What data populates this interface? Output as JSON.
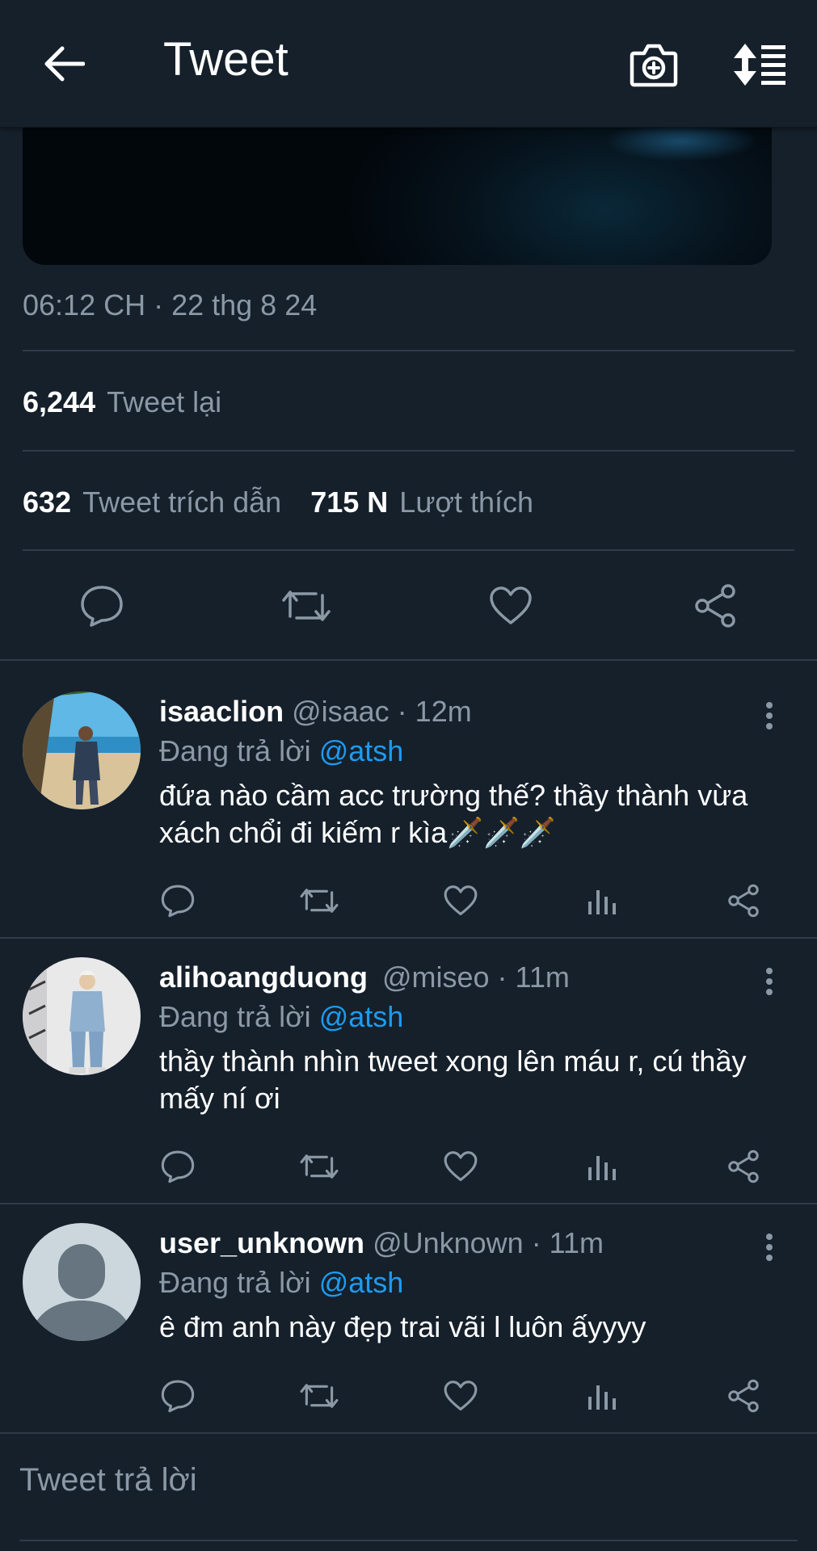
{
  "header": {
    "title": "Tweet",
    "back_icon": "arrow-left-icon",
    "camera_icon": "camera-plus-icon",
    "sort_icon": "sort-list-icon"
  },
  "tweet": {
    "timestamp": "06:12 CH · 22 thg 8 24",
    "retweets": {
      "count": "6,244",
      "label": "Tweet lại"
    },
    "quotes": {
      "count": "632",
      "label": "Tweet trích dẫn"
    },
    "likes": {
      "count": "715 N",
      "label": "Lượt thích"
    }
  },
  "colors": {
    "background": "#15202b",
    "divider": "#2f3b47",
    "secondary_text": "#8b98a5",
    "accent": "#1d9bf0"
  },
  "replies": [
    {
      "username": "isaaclion",
      "meta": "@isaac · 12m",
      "replying_prefix": "Đang trả lời",
      "mention": "@atsh",
      "text": "đứa nào cầm acc trường thế? thầy thành vừa xách chổi đi kiếm r kìa🗡️🗡️🗡️"
    },
    {
      "username": "alihoangduong",
      "meta": "@miseo · 11m",
      "replying_prefix": "Đang trả lời",
      "mention": "@atsh",
      "text": "thầy thành nhìn tweet xong lên máu r, cú thầy mấy ní ơi"
    },
    {
      "username": "user_unknown",
      "meta": "@Unknown · 11m",
      "replying_prefix": "Đang trả lời",
      "mention": "@atsh",
      "text": "ê đm anh này đẹp trai vãi l luôn ấyyyy"
    }
  ],
  "composer": {
    "placeholder": "Tweet trả lời"
  }
}
